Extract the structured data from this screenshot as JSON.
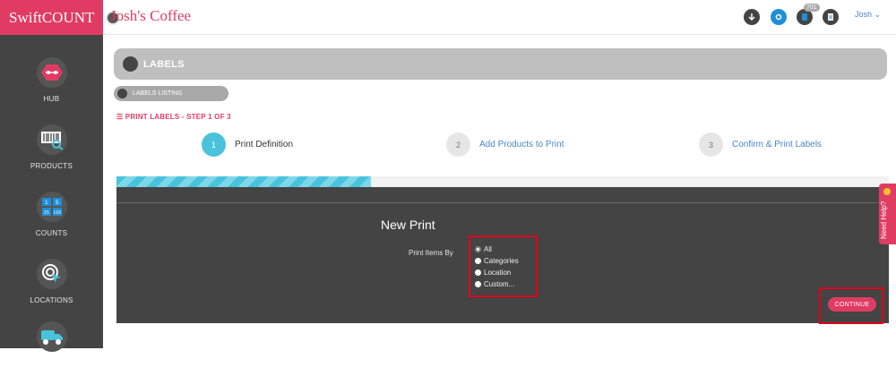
{
  "app": {
    "brand": "SwiftCOUNT",
    "shop_name": "Josh's Coffee"
  },
  "header": {
    "notification_count": "701",
    "user_menu": "Josh ⌄"
  },
  "sidebar": {
    "items": [
      {
        "label": "HUB",
        "icon": "hub-icon"
      },
      {
        "label": "PRODUCTS",
        "icon": "barcode-search-icon"
      },
      {
        "label": "COUNTS",
        "icon": "counts-grid-icon"
      },
      {
        "label": "LOCATIONS",
        "icon": "location-target-icon"
      },
      {
        "label": "",
        "icon": "truck-icon"
      }
    ]
  },
  "page": {
    "title": "LABELS",
    "back_label": "LABELS LISTING",
    "step_title": "PRINT LABELS - STEP 1 OF 3",
    "steps": [
      {
        "num": "1",
        "label": "Print Definition",
        "active": true
      },
      {
        "num": "2",
        "label": "Add Products to Print",
        "active": false
      },
      {
        "num": "3",
        "label": "Confirm & Print Labels",
        "active": false
      }
    ],
    "progress_fraction": 0.33
  },
  "form": {
    "heading": "New Print",
    "print_items_by_label": "Print Items By",
    "options": [
      "All",
      "Categories",
      "Location",
      "Custom..."
    ],
    "selected": "All",
    "continue_label": "CONTINUE"
  },
  "help": {
    "label": "Need Help?"
  },
  "colors": {
    "brand": "#e03c63",
    "sidebar": "#444444",
    "accent": "#49c3dc",
    "highlight_box": "#e0001b"
  }
}
